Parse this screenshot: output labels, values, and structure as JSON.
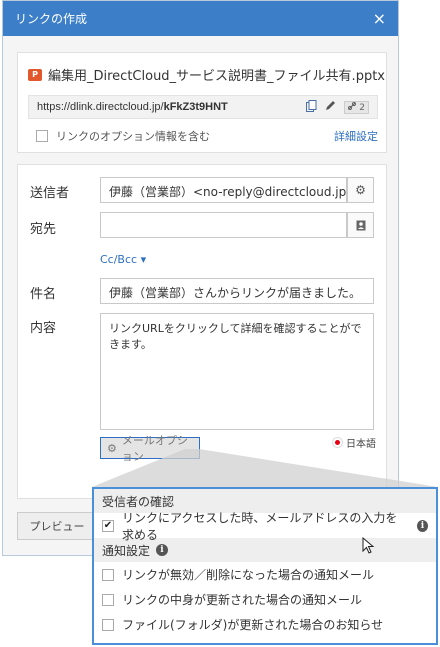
{
  "dialog": {
    "title": "リンクの作成",
    "close_glyph": "×"
  },
  "file": {
    "icon": "pptx-file-icon",
    "name": "編集用_DirectCloud_サービス説明書_ファイル共有.pptx",
    "url_prefix": "https://dlink.directcloud.jp/",
    "url_code": "kFkZ3t9HNT",
    "link_count": "2"
  },
  "link_options": {
    "include_label": "リンクのオプション情報を含む",
    "include_checked": false,
    "details_link": "詳細設定"
  },
  "form": {
    "sender_label": "送信者",
    "sender_value": "伊藤（営業部）<no-reply@directcloud.jp>",
    "recipient_label": "宛先",
    "recipient_value": "",
    "cc_bcc": "Cc/Bcc",
    "subject_label": "件名",
    "subject_value": "伊藤（営業部）さんからリンクが届きました。",
    "body_label": "内容",
    "body_value": "リンクURLをクリックして詳細を確認することができます。",
    "mail_options": "メールオプション",
    "language": "日本語"
  },
  "buttons": {
    "preview": "プレビュー"
  },
  "mail_options_popup": {
    "section1_title": "受信者の確認",
    "section1_items": [
      {
        "label": "リンクにアクセスした時、メールアドレスの入力を求める",
        "checked": true
      }
    ],
    "section2_title": "通知設定",
    "section2_items": [
      {
        "label": "リンクが無効／削除になった場合の通知メール",
        "checked": false
      },
      {
        "label": "リンクの中身が更新された場合の通知メール",
        "checked": false
      },
      {
        "label": "ファイル(フォルダ)が更新された場合のお知らせ",
        "checked": false
      }
    ]
  },
  "colors": {
    "titlebar": "#3c7fc8",
    "accent": "#2d6fc2",
    "popup_border": "#4a8fd8",
    "file_icon": "#e2582c"
  }
}
